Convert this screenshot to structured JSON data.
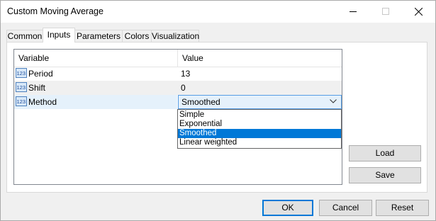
{
  "window": {
    "title": "Custom Moving Average"
  },
  "tabs": [
    {
      "label": "Common"
    },
    {
      "label": "Inputs"
    },
    {
      "label": "Parameters"
    },
    {
      "label": "Colors"
    },
    {
      "label": "Visualization"
    }
  ],
  "grid": {
    "col_variable": "Variable",
    "col_value": "Value",
    "rows": [
      {
        "icon": "123",
        "name": "Period",
        "value": "13"
      },
      {
        "icon": "123",
        "name": "Shift",
        "value": "0"
      },
      {
        "icon": "123",
        "name": "Method",
        "value": "Smoothed"
      }
    ]
  },
  "dropdown": {
    "selected": "Smoothed",
    "options": [
      "Simple",
      "Exponential",
      "Smoothed",
      "Linear weighted"
    ]
  },
  "side_buttons": {
    "load": "Load",
    "save": "Save"
  },
  "footer": {
    "ok": "OK",
    "cancel": "Cancel",
    "reset": "Reset"
  },
  "colors": {
    "accent": "#0078d7",
    "selection_bg": "#0078d7",
    "row_hover": "#e5f1fb"
  }
}
